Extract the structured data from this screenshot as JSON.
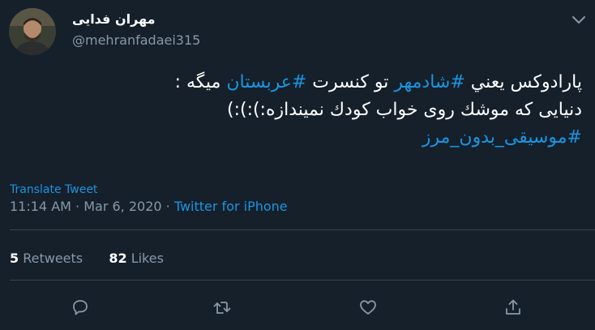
{
  "tweet": {
    "author": {
      "display_name": "مهران فدایی",
      "handle": "@mehranfadaei315"
    },
    "body": {
      "line1": {
        "part1": "پارادوکس یعني ",
        "hashtag1": "#شادمهر",
        "part2": " تو کنسرت ",
        "hashtag2": "#عربستان",
        "part3": " میگه :"
      },
      "line2": "دنیایی که موشك روی خواب کودك نمیندازه:):):)",
      "line3_hashtag": "#موسیقی_بدون_مرز"
    },
    "translate_label": "Translate Tweet",
    "time": "11:14 AM",
    "date": "Mar 6, 2020",
    "separator": " · ",
    "source": "Twitter for iPhone",
    "stats": {
      "retweets_count": "5",
      "retweets_label": "Retweets",
      "likes_count": "82",
      "likes_label": "Likes"
    },
    "actions": [
      "reply-icon",
      "retweet-icon",
      "like-icon",
      "share-icon"
    ]
  },
  "colors": {
    "background": "#15202b",
    "text": "#ffffff",
    "secondary": "#8899a6",
    "accent": "#1b95e0",
    "divider": "#38444d"
  }
}
